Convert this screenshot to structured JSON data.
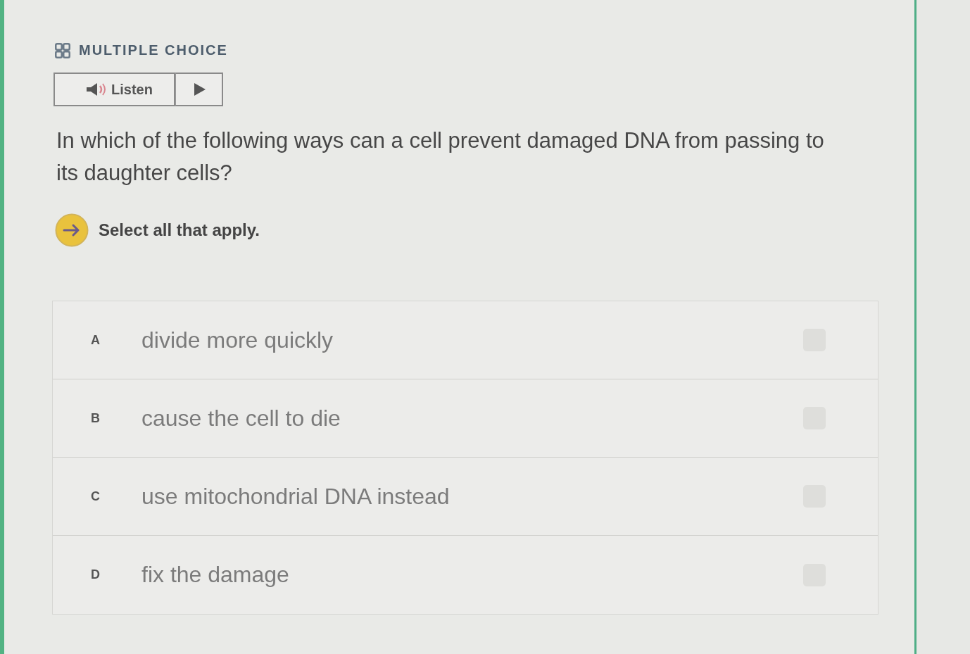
{
  "question_type": {
    "label": "MULTIPLE CHOICE"
  },
  "listen": {
    "label": "Listen"
  },
  "question": "In which of the following ways can a cell prevent damaged DNA from passing to its daughter cells?",
  "instruction": "Select all that apply.",
  "options": [
    {
      "letter": "A",
      "text": "divide more quickly",
      "checked": false
    },
    {
      "letter": "B",
      "text": "cause the cell to die",
      "checked": false
    },
    {
      "letter": "C",
      "text": "use mitochondrial DNA instead",
      "checked": false
    },
    {
      "letter": "D",
      "text": "fix the damage",
      "checked": false
    }
  ]
}
